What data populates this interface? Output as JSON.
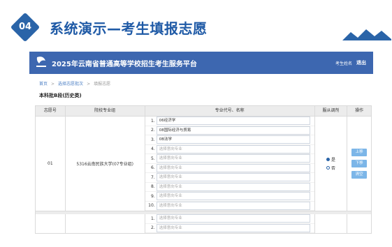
{
  "slide": {
    "badge": "04",
    "title": "系统演示—考生填报志愿"
  },
  "platform": {
    "title": "2025年云南省普通高等学校招生考生服务平台",
    "user_link": "考生姓名",
    "logout": "退出",
    "breadcrumb": [
      "首页",
      "选择志愿批次",
      "填报志愿"
    ],
    "section_title": "本科批B段(历史类)",
    "table": {
      "headers": [
        "志愿号",
        "院校专业组",
        "专业代号、名称",
        "服从调剂",
        "操作"
      ],
      "groups": [
        {
          "number": "01",
          "school": "5316云南民族大学(07专业组)",
          "majors": [
            {
              "n": "1.",
              "text": "06经济学",
              "filled": true
            },
            {
              "n": "2.",
              "text": "08国际经济与贸易",
              "filled": true
            },
            {
              "n": "3.",
              "text": "0B法学",
              "filled": true
            },
            {
              "n": "4.",
              "text": "选择意向专业",
              "filled": false
            },
            {
              "n": "5.",
              "text": "选择意向专业",
              "filled": false
            },
            {
              "n": "6.",
              "text": "选择意向专业",
              "filled": false
            },
            {
              "n": "7.",
              "text": "选择意向专业",
              "filled": false
            },
            {
              "n": "8.",
              "text": "选择意向专业",
              "filled": false
            },
            {
              "n": "9.",
              "text": "选择意向专业",
              "filled": false
            },
            {
              "n": "10.",
              "text": "选择意向专业",
              "filled": false
            }
          ],
          "obey": {
            "yes": "是",
            "no": "否",
            "selected": "是"
          },
          "actions": [
            "上移",
            "下移",
            "清空"
          ]
        },
        {
          "majors": [
            {
              "n": "1.",
              "text": "选择意向专业",
              "filled": false
            },
            {
              "n": "2.",
              "text": "选择意向专业",
              "filled": false
            }
          ]
        }
      ]
    }
  },
  "colors": {
    "brand": "#3d67b0",
    "accent": "#1f5aa6",
    "button": "#7cb6e8"
  }
}
